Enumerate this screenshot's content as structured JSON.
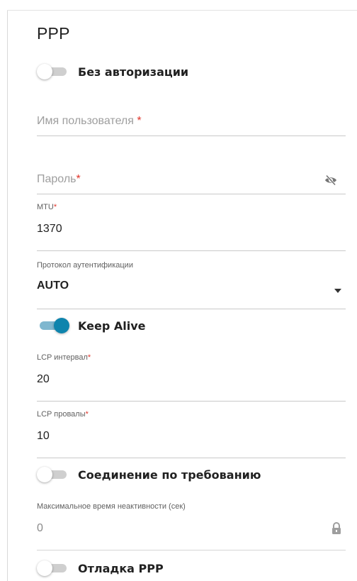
{
  "section": {
    "title": "PPP"
  },
  "no_auth": {
    "label": "Без авторизации",
    "checked": false
  },
  "username": {
    "placeholder": "Имя пользователя",
    "required_mark": " *"
  },
  "password": {
    "placeholder": "Пароль",
    "required_mark": "*"
  },
  "mtu": {
    "label": "MTU",
    "required_mark": "*",
    "value": "1370"
  },
  "auth_protocol": {
    "label": "Протокол аутентификации",
    "value": "AUTO"
  },
  "keep_alive": {
    "label": "Keep Alive",
    "checked": true
  },
  "lcp_interval": {
    "label": "LCP интервал",
    "required_mark": "*",
    "value": "20"
  },
  "lcp_failures": {
    "label": "LCP провалы",
    "required_mark": "*",
    "value": "10"
  },
  "on_demand": {
    "label": "Соединение по требованию",
    "checked": false
  },
  "max_idle": {
    "label": "Максимальное время неактивности (сек)",
    "value": "0"
  },
  "ppp_debug": {
    "label": "Отладка PPP",
    "checked": false
  },
  "colors": {
    "accent": "#0e84ad",
    "accent_track": "#7fb7cf",
    "required": "#e0352b"
  },
  "icons": {
    "password_toggle": "eye-off-icon",
    "locked": "lock-icon",
    "dropdown": "caret-down-icon"
  }
}
